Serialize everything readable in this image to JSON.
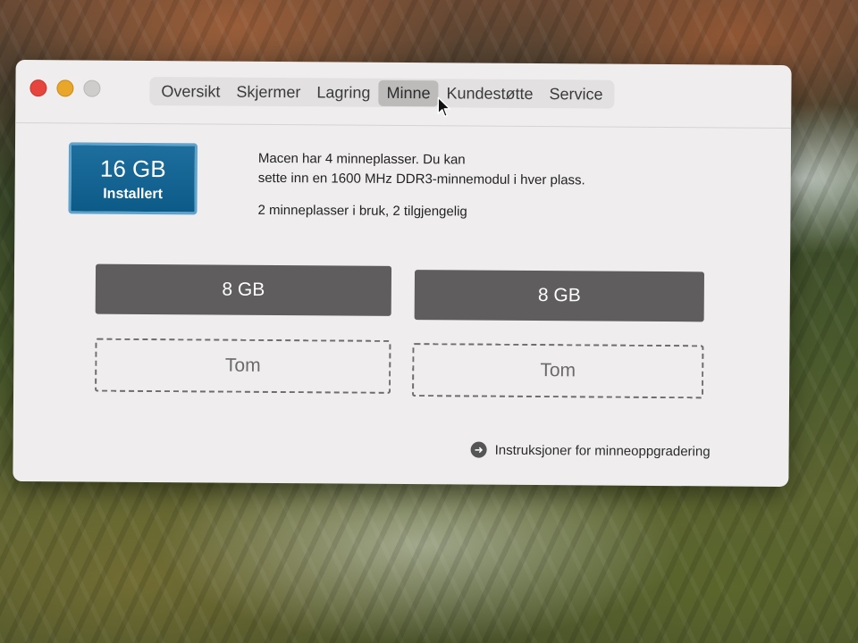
{
  "window": {
    "tabs": [
      {
        "label": "Oversikt",
        "active": false
      },
      {
        "label": "Skjermer",
        "active": false
      },
      {
        "label": "Lagring",
        "active": false
      },
      {
        "label": "Minne",
        "active": true
      },
      {
        "label": "Kundestøtte",
        "active": false
      },
      {
        "label": "Service",
        "active": false
      }
    ]
  },
  "memory": {
    "installed_size": "16 GB",
    "installed_label": "Installert",
    "description_line1": "Macen har 4 minneplasser. Du kan",
    "description_line2": "sette inn en 1600 MHz DDR3-minnemodul i hver plass.",
    "slots_status": "2 minneplasser i bruk, 2 tilgjengelig",
    "slots": [
      {
        "label": "8 GB",
        "state": "filled"
      },
      {
        "label": "8 GB",
        "state": "filled"
      },
      {
        "label": "Tom",
        "state": "empty"
      },
      {
        "label": "Tom",
        "state": "empty"
      }
    ],
    "upgrade_link": "Instruksjoner for minneoppgradering"
  },
  "colors": {
    "installed_badge": "#0c5a88",
    "filled_slot": "#5f5d5d",
    "close": "#e6453d",
    "minimize": "#e8a62b"
  },
  "icons": {
    "upgrade": "arrow-right-circle-icon",
    "cursor": "pointer-cursor-icon"
  }
}
